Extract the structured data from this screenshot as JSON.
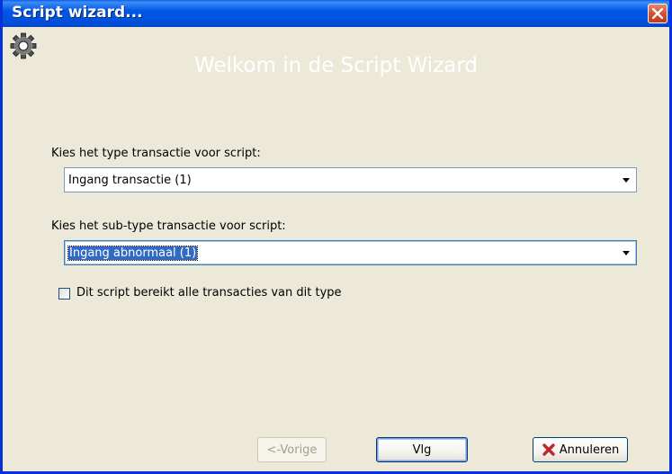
{
  "window": {
    "title": "Script wizard...",
    "close_icon": "close-icon"
  },
  "header": {
    "icon": "gear-icon",
    "welcome": "Welkom in de Script Wizard"
  },
  "form": {
    "type_label": "Kies het type transactie voor script:",
    "type_value": "Ingang transactie  (1)",
    "subtype_label": "Kies het sub-type transactie voor script:",
    "subtype_value": "Ingang abnormaal  (1)",
    "checkbox_label": "Dit script bereikt alle transacties van dit type",
    "checkbox_checked": false
  },
  "buttons": {
    "prev_label": "<-Vorige",
    "next_label": "Vlg",
    "cancel_label": "Annuleren",
    "cancel_icon": "x-icon"
  },
  "colors": {
    "titlebar": "#0058e6",
    "face": "#ece9d8",
    "selection": "#316ac5",
    "cancel_x": "#c0272d"
  }
}
